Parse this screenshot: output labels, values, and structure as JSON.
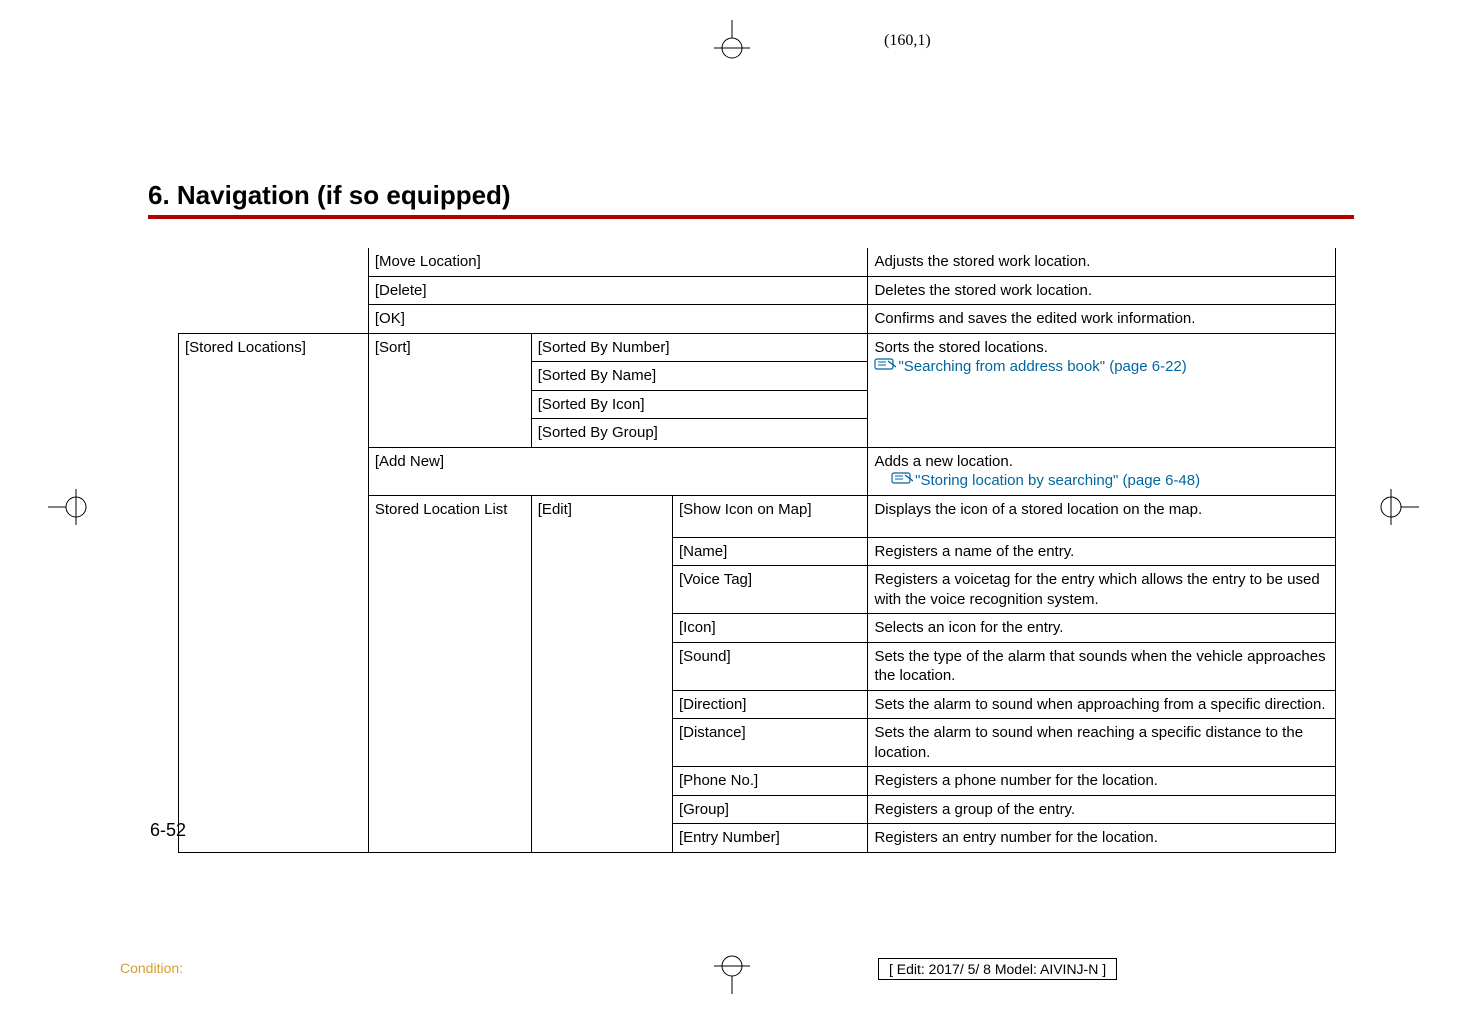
{
  "page_coord": "(160,1)",
  "heading": "6. Navigation (if so equipped)",
  "col1": {
    "stored_locations": "[Stored Locations]"
  },
  "col2": {
    "move_location": "[Move Location]",
    "delete": "[Delete]",
    "ok": "[OK]",
    "sort": "[Sort]",
    "add_new": "[Add New]",
    "stored_location_list": "Stored Location List"
  },
  "col3": {
    "sorted_by_number": "[Sorted By Number]",
    "sorted_by_name": "[Sorted By Name]",
    "sorted_by_icon": "[Sorted By Icon]",
    "sorted_by_group": "[Sorted By Group]",
    "edit": "[Edit]"
  },
  "col4": {
    "show_icon_on_map": "[Show Icon on Map]",
    "name": "[Name]",
    "voice_tag": "[Voice Tag]",
    "icon": "[Icon]",
    "sound": "[Sound]",
    "direction": "[Direction]",
    "distance": "[Distance]",
    "phone_no": "[Phone No.]",
    "group": "[Group]",
    "entry_number": "[Entry Number]"
  },
  "desc": {
    "move_location": "Adjusts the stored work location.",
    "delete": "Deletes the stored work location.",
    "ok": "Confirms and saves the edited work information.",
    "sort_line1": "Sorts the stored locations.",
    "sort_link": "\"Searching from address book\" (page 6-22)",
    "add_new_line1": "Adds a new location.",
    "add_new_link": "\"Storing location by searching\" (page 6-48)",
    "show_icon_on_map": "Displays the icon of a stored location on the map.",
    "name": "Registers a name of the entry.",
    "voice_tag": "Registers a voicetag for the entry which allows the entry to be used with the voice recognition system.",
    "icon_d": "Selects an icon for the entry.",
    "sound": "Sets the type of the alarm that sounds when the vehicle approaches the location.",
    "direction": "Sets the alarm to sound when approaching from a specific direction.",
    "distance": "Sets the alarm to sound when reaching a specific distance to the location.",
    "phone_no": "Registers a phone number for the location.",
    "group": "Registers a group of the entry.",
    "entry_number": "Registers an entry number for the location."
  },
  "page_num": "6-52",
  "condition": "Condition:",
  "edit_info": "[ Edit: 2017/ 5/ 8   Model: AIVINJ-N ]"
}
